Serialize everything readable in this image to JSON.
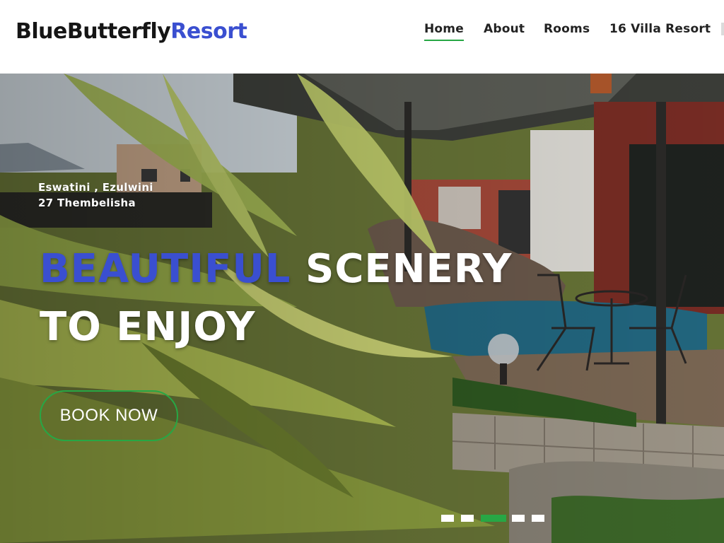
{
  "brand": {
    "name_part1": "BlueButterfly",
    "name_part2": "Resort"
  },
  "nav": {
    "items": [
      {
        "label": "Home",
        "active": true
      },
      {
        "label": "About",
        "active": false
      },
      {
        "label": "Rooms",
        "active": false
      },
      {
        "label": "16 Villa Resort",
        "active": false
      }
    ]
  },
  "hero": {
    "location_line1": "Eswatini , Ezulwini",
    "location_line2": "27 Thembelisha",
    "headline_accent": "BEAUTIFUL",
    "headline_rest": "SCENERY",
    "headline_line2": "TO ENJOY",
    "cta_label": "BOOK NOW",
    "slides_total": 5,
    "slide_active": 3
  },
  "colors": {
    "brand_blue": "#3a4fd0",
    "accent_green": "#27a745",
    "text_dark": "#222222"
  }
}
